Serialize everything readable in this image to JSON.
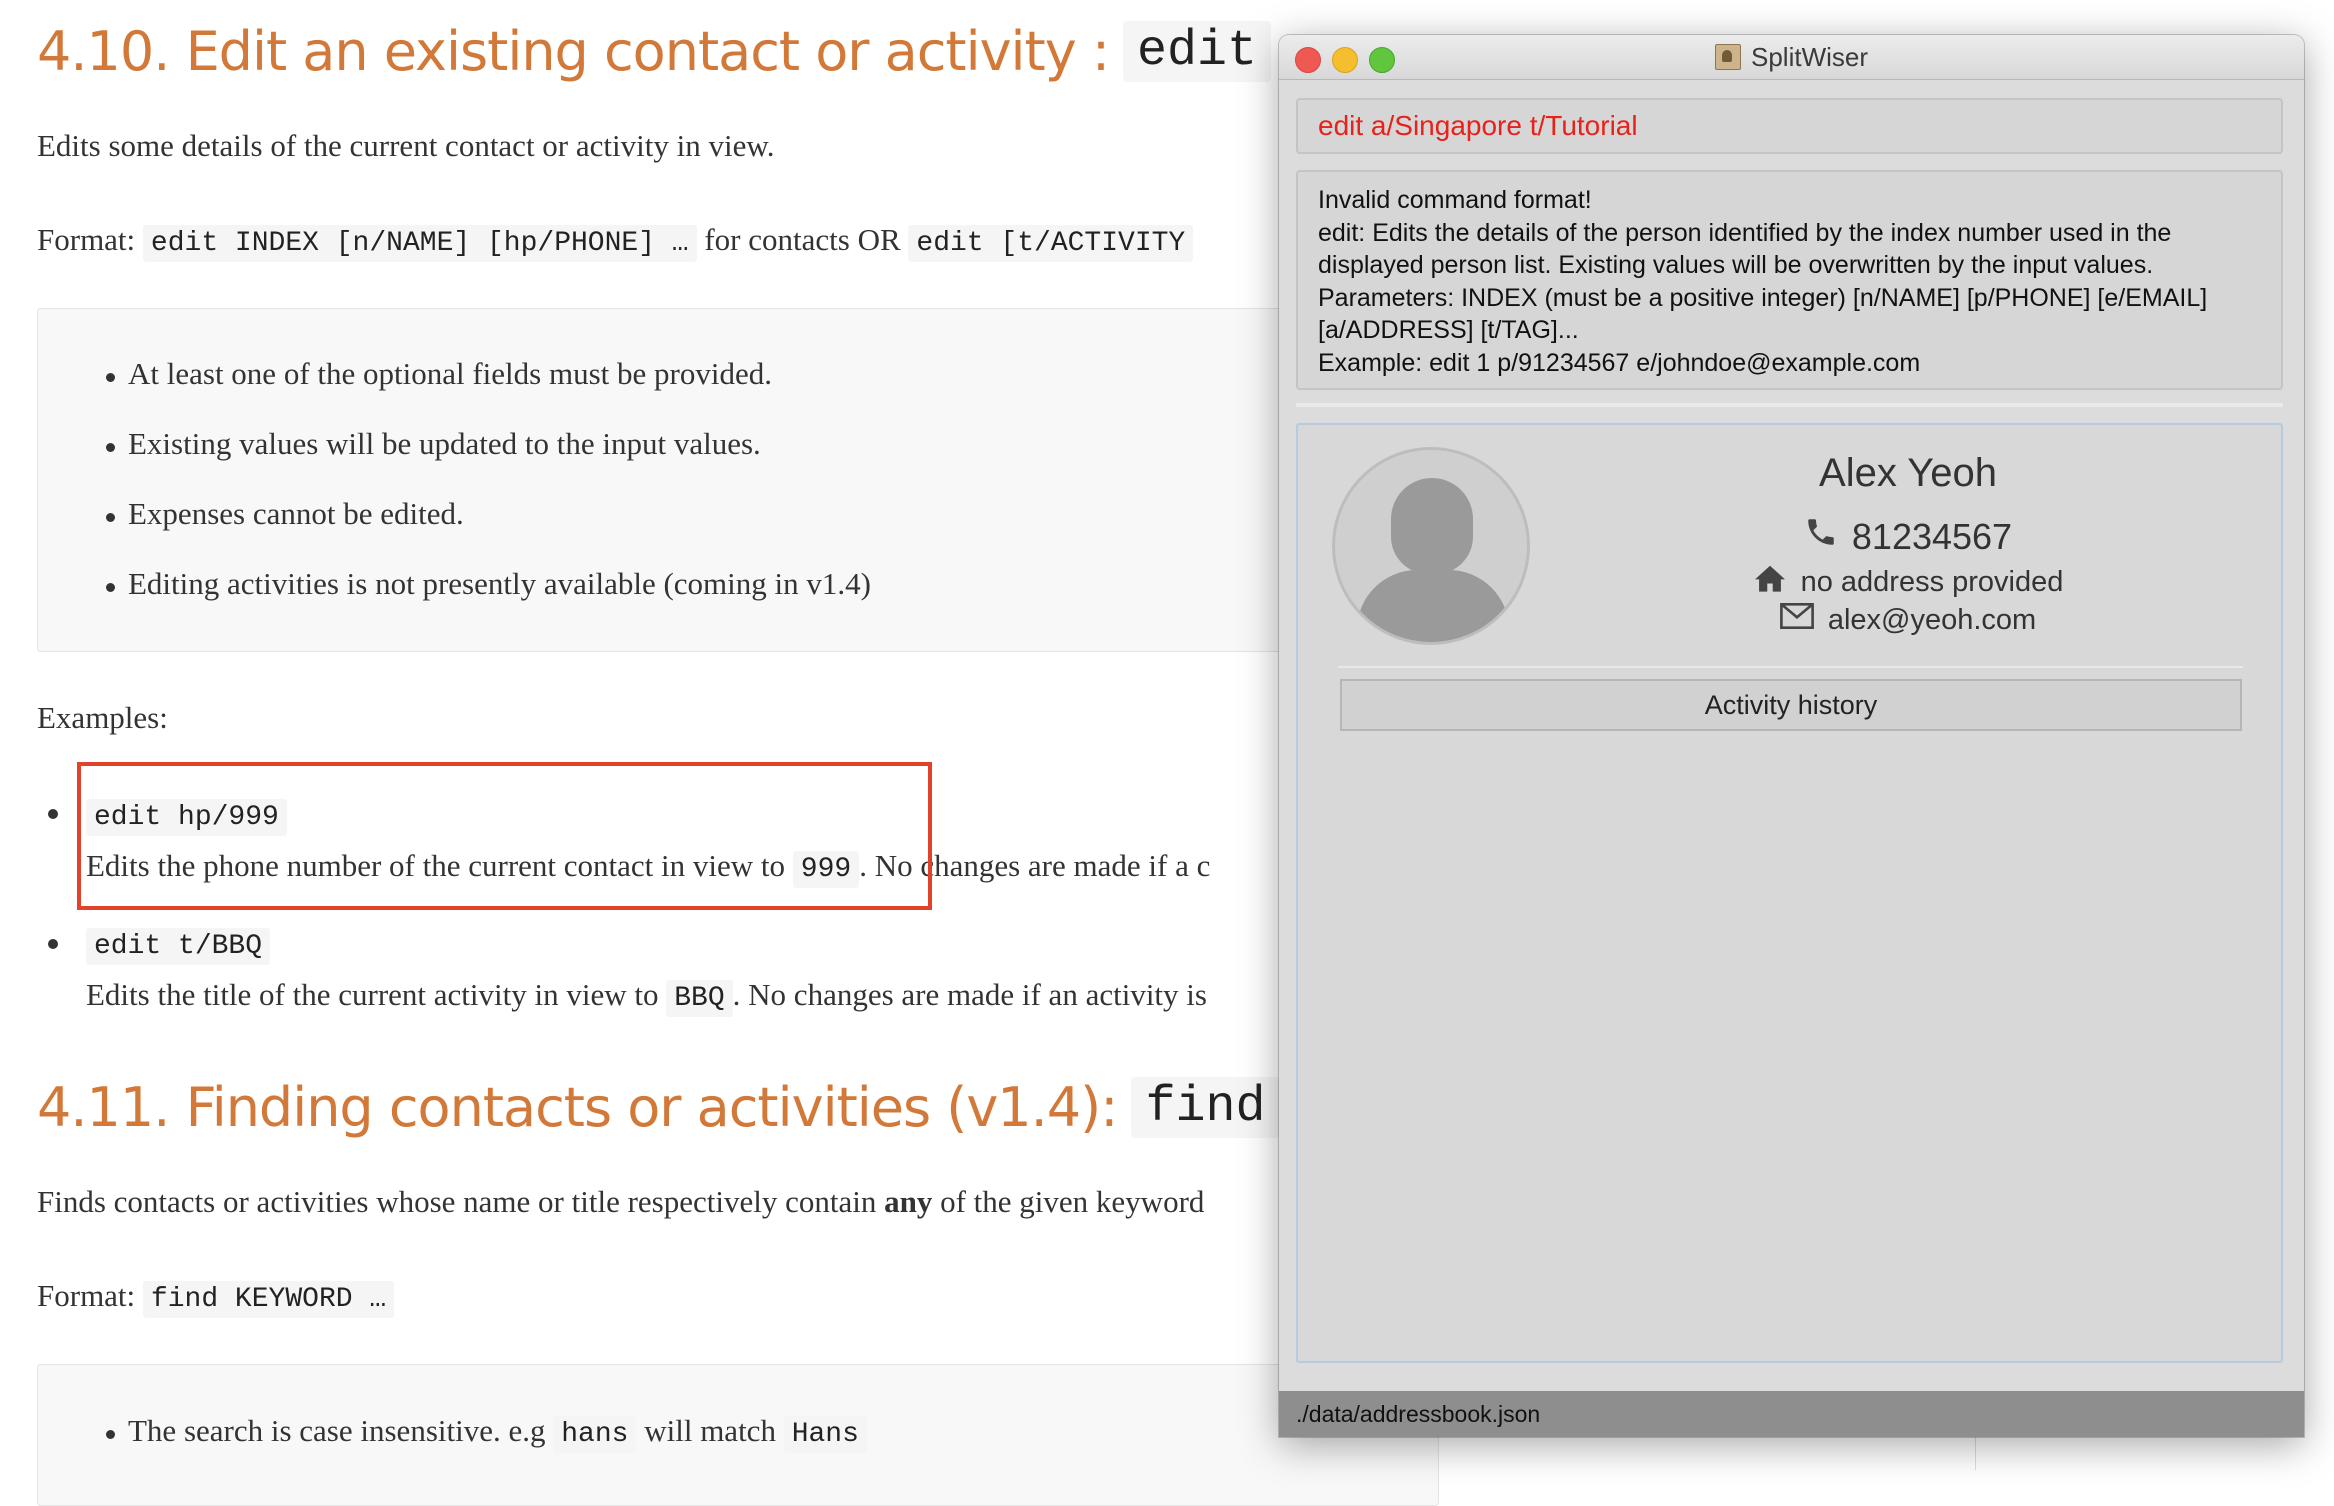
{
  "doc": {
    "section_410": {
      "title": "4.10. Edit an existing contact or activity :",
      "code": "edit"
    },
    "intro": "Edits some details of the current contact or activity in view.",
    "format": {
      "label": "Format:",
      "code1": "edit INDEX [n/NAME] [hp/PHONE] …",
      "mid": "for contacts OR",
      "code2": "edit [t/ACTIVITY"
    },
    "notes": [
      "At least one of the optional fields must be provided.",
      "Existing values will be updated to the input values.",
      "Expenses cannot be edited.",
      "Editing activities is not presently available (coming in v1.4)"
    ],
    "examples_label": "Examples:",
    "examples": [
      {
        "code": "edit hp/999",
        "desc_pre": "Edits the phone number of the current contact in view to",
        "desc_code": "999",
        "desc_post": ". No changes are made if a c"
      },
      {
        "code": "edit t/BBQ",
        "desc_pre": "Edits the title of the current activity in view to",
        "desc_code": "BBQ",
        "desc_post": ". No changes are made if an activity is"
      }
    ],
    "section_411": {
      "title": "4.11. Finding contacts or activities (v1.4):",
      "code": "find"
    },
    "find_intro": {
      "pre": "Finds contacts or activities whose name or title respectively contain",
      "bold": "any",
      "post": "of the given keyword"
    },
    "find_format": {
      "label": "Format:",
      "code": "find KEYWORD …"
    },
    "find_note": {
      "pre": "The search is case insensitive. e.g",
      "code1": "hans",
      "mid": "will match",
      "code2": "Hans"
    }
  },
  "app": {
    "title": "SplitWiser",
    "command_text": "edit a/Singapore t/Tutorial",
    "result_lines": [
      "Invalid command format!",
      "edit: Edits the details of the person identified by the index number used in the",
      "displayed person list. Existing values will be overwritten by the input values.",
      "Parameters: INDEX (must be a positive integer) [n/NAME] [p/PHONE] [e/EMAIL]",
      "[a/ADDRESS] [t/TAG]...",
      "Example: edit 1 p/91234567 e/johndoe@example.com"
    ],
    "person": {
      "name": "Alex Yeoh",
      "phone": "81234567",
      "address": "no address provided",
      "email": "alex@yeoh.com"
    },
    "activity_button": "Activity history",
    "status_path": "./data/addressbook.json",
    "icons": [
      "phone-icon",
      "home-icon",
      "envelope-icon",
      "avatar-icon",
      "app-icon"
    ],
    "colors": {
      "heading": "#d27939",
      "error_text": "#e8211a",
      "highlight_box": "#e2412a"
    }
  }
}
